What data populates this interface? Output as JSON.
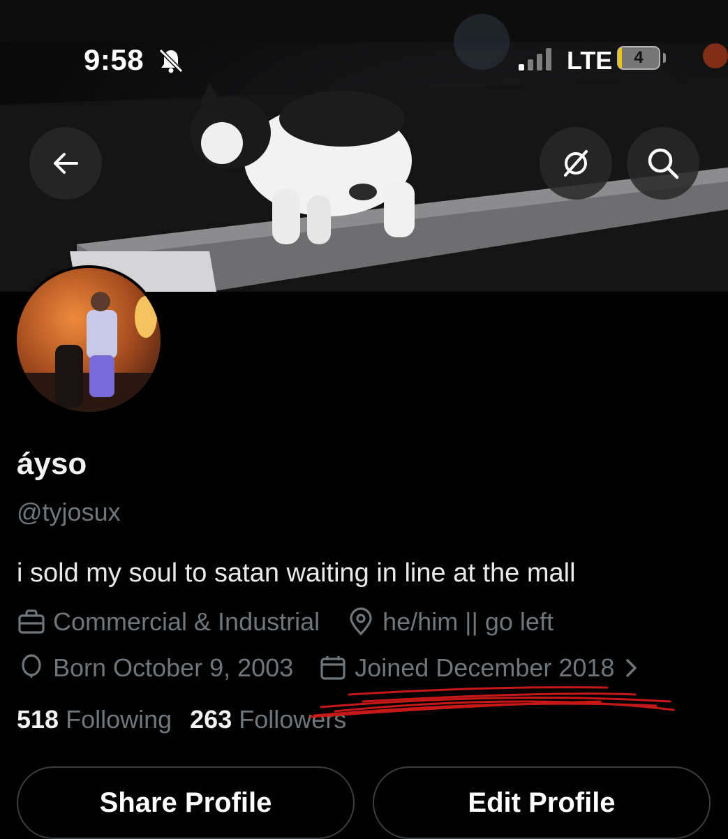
{
  "status_bar": {
    "time": "9:58",
    "network": "LTE",
    "battery": "4",
    "battery_fraction": 0.04
  },
  "header": {
    "back_icon": "arrow-left-icon",
    "grok_icon": "grok-icon",
    "search_icon": "search-icon"
  },
  "profile": {
    "display_name": "áyso",
    "handle": "@tyjosux",
    "bio": "i sold my soul to satan waiting in line at the mall",
    "category": "Commercial & Industrial",
    "location": "he/him || go left",
    "birthday": "Born October 9, 2003",
    "joined": "Joined December 2018",
    "following_count": "518",
    "following_label": "Following",
    "followers_count": "263",
    "followers_label": "Followers"
  },
  "actions": {
    "share_label": "Share Profile",
    "edit_label": "Edit Profile"
  },
  "annotation": {
    "scribble_color": "#d21a1a"
  }
}
